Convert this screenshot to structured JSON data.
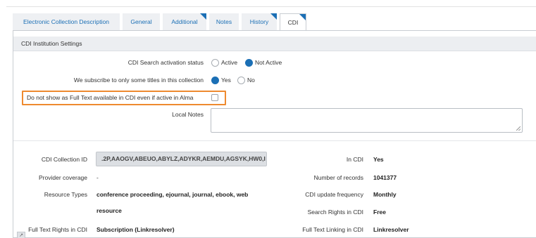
{
  "tabs": [
    {
      "label": "Electronic Collection Description",
      "active": false,
      "marked": false
    },
    {
      "label": "General",
      "active": false,
      "marked": false
    },
    {
      "label": "Additional",
      "active": false,
      "marked": true
    },
    {
      "label": "Notes",
      "active": false,
      "marked": false
    },
    {
      "label": "History",
      "active": false,
      "marked": true
    },
    {
      "label": "CDI",
      "active": true,
      "marked": true
    }
  ],
  "section": {
    "title": "CDI Institution Settings"
  },
  "settings": {
    "search_activation": {
      "label": "CDI Search activation status",
      "options": [
        "Active",
        "Not Active"
      ],
      "selected": "Not Active"
    },
    "subscribe_some": {
      "label": "We subscribe to only some titles in this collection",
      "options": [
        "Yes",
        "No"
      ],
      "selected": "Yes"
    },
    "no_full_text": {
      "label": "Do not show as Full Text available in CDI even if active in Alma",
      "checked": false
    },
    "local_notes": {
      "label": "Local Notes",
      "value": ""
    }
  },
  "details_left": {
    "collection_id_label": "CDI Collection ID",
    "collection_id_value": ".2P,AAOGV,ABEUO,ABYLZ,ADYKR,AEMDU,AGSYK,HW0,I",
    "provider_coverage_label": "Provider coverage",
    "provider_coverage_value": "-",
    "resource_types_label": "Resource Types",
    "resource_types_line1": "conference proceeding, ejournal, journal, ebook, web",
    "resource_types_line2": "resource",
    "full_text_rights_label": "Full Text Rights in CDI",
    "full_text_rights_value": "Subscription (Linkresolver)"
  },
  "details_right": {
    "in_cdi_label": "In CDI",
    "in_cdi_value": "Yes",
    "num_records_label": "Number of records",
    "num_records_value": "1041377",
    "update_freq_label": "CDI update frequency",
    "update_freq_value": "Monthly",
    "search_rights_label": "Search Rights in CDI",
    "search_rights_value": "Free",
    "full_text_linking_label": "Full Text Linking in CDI",
    "full_text_linking_value": "Linkresolver"
  },
  "colors": {
    "accent": "#1b6fb5",
    "highlight": "#ee8a2f",
    "header_bg": "#eceef1"
  }
}
